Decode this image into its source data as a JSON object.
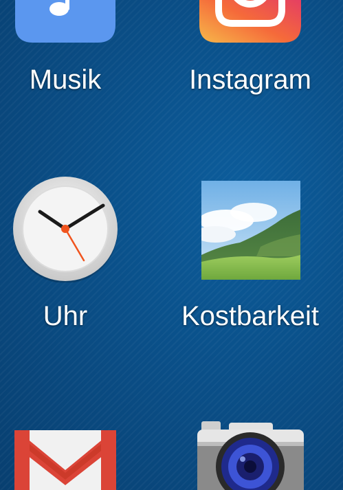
{
  "home_screen": {
    "apps": [
      {
        "label": "Musik",
        "icon": "music-note-icon",
        "color": "#5b97ef"
      },
      {
        "label": "Instagram",
        "icon": "instagram-icon",
        "color": "#f5574f"
      },
      {
        "label": "Uhr",
        "icon": "clock-icon",
        "color": "#e8e8e8"
      },
      {
        "label": "Kostbarkeit",
        "icon": "landscape-photo-icon",
        "color": "#8fc45a"
      },
      {
        "label": "",
        "icon": "gmail-icon",
        "color": "#db4437"
      },
      {
        "label": "",
        "icon": "camera-icon",
        "color": "#d9d9d9"
      }
    ]
  },
  "wallpaper_color": "#0a4e86"
}
